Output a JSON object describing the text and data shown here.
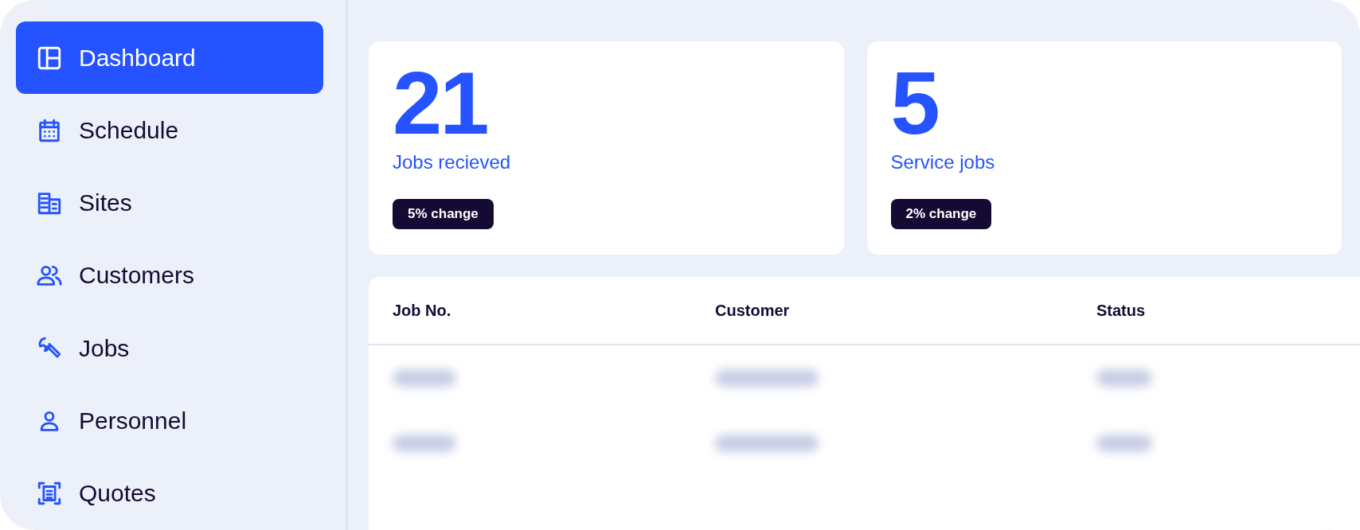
{
  "sidebar": {
    "items": [
      {
        "label": "Dashboard",
        "selected": true
      },
      {
        "label": "Schedule",
        "selected": false
      },
      {
        "label": "Sites",
        "selected": false
      },
      {
        "label": "Customers",
        "selected": false
      },
      {
        "label": "Jobs",
        "selected": false
      },
      {
        "label": "Personnel",
        "selected": false
      },
      {
        "label": "Quotes",
        "selected": false
      }
    ]
  },
  "stats": [
    {
      "value": "21",
      "label": "Jobs recieved",
      "badge": "5% change"
    },
    {
      "value": "5",
      "label": "Service jobs",
      "badge": "2% change"
    }
  ],
  "table": {
    "columns": [
      "Job No.",
      "Customer",
      "Status"
    ],
    "rows": [
      {
        "redacted": true
      },
      {
        "redacted": true
      }
    ]
  }
}
